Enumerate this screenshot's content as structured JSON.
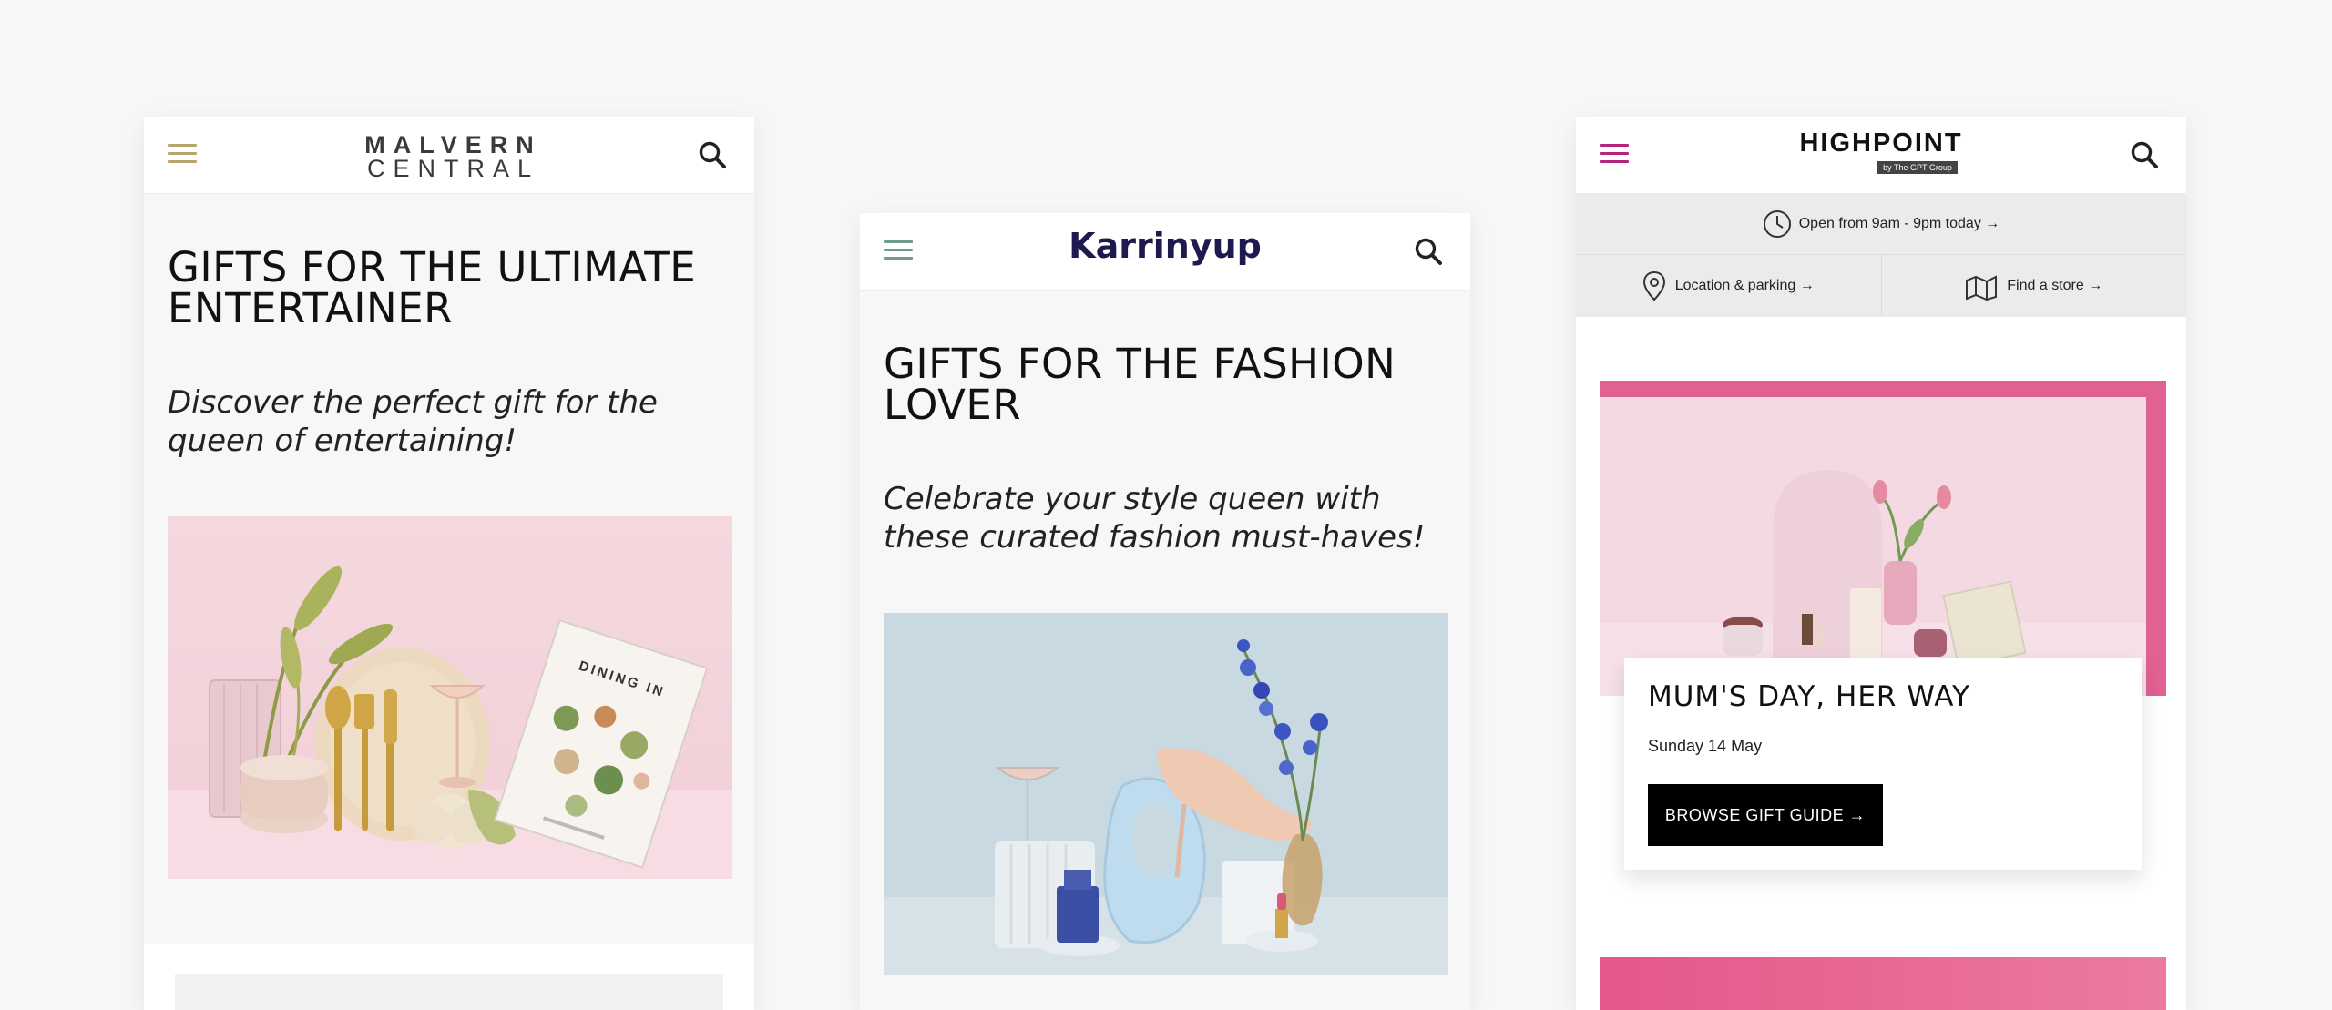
{
  "screens": [
    {
      "logo_line1": "MALVERN",
      "logo_line2": "CENTRAL",
      "title": "GIFTS FOR THE ULTIMATE ENTERTAINER",
      "subtitle": "Discover the perfect gift for the queen of entertaining!",
      "book_title": "DINING IN",
      "icons": [
        "menu-icon",
        "search-icon"
      ],
      "accent": "#b8a46d"
    },
    {
      "logo": "Karrinyup",
      "title": "GIFTS FOR THE FASHION LOVER",
      "subtitle": "Celebrate your style queen with these curated fashion must-haves!",
      "icons": [
        "menu-icon",
        "search-icon"
      ],
      "accent": "#6e9c8a"
    },
    {
      "logo": "HIGHPOINT",
      "logo_sub": "by The GPT Group",
      "hours": "Open from 9am - 9pm today →",
      "location": "Location & parking →",
      "find_store": "Find a store →",
      "promo_title": "MUM'S DAY, HER WAY",
      "promo_date": "Sunday 14 May",
      "promo_button": "BROWSE GIFT GUIDE →",
      "icons": [
        "menu-icon",
        "search-icon",
        "clock-icon",
        "map-pin-icon",
        "map-icon"
      ],
      "accent": "#b3247f"
    }
  ]
}
